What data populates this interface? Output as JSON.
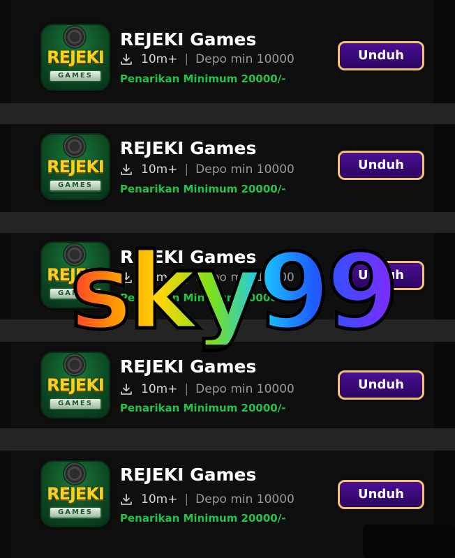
{
  "watermark": "sky99",
  "icon": {
    "word": "REJEKI",
    "sub": "GAMES",
    "name": "rejeki-games-logo"
  },
  "colors": {
    "background": "#242424",
    "card": "#0c0c0c",
    "title": "#ffffff",
    "withdraw": "#25c24a",
    "button_bg": "#3a0a7a",
    "button_border": "#f3c56b"
  },
  "apps": [
    {
      "title": "REJEKI Games",
      "downloads": "10m+",
      "separator": "|",
      "deposit": "Depo min 10000",
      "withdraw": "Penarikan Minimum 20000/-",
      "button": "Unduh"
    },
    {
      "title": "REJEKI Games",
      "downloads": "10m+",
      "separator": "|",
      "deposit": "Depo min 10000",
      "withdraw": "Penarikan Minimum 20000/-",
      "button": "Unduh"
    },
    {
      "title": "REJEKI Games",
      "downloads": "10m+",
      "separator": "|",
      "deposit": "Depo min 10000",
      "withdraw": "Penarikan Minimum 20000/-",
      "button": "Unduh"
    },
    {
      "title": "REJEKI Games",
      "downloads": "10m+",
      "separator": "|",
      "deposit": "Depo min 10000",
      "withdraw": "Penarikan Minimum 20000/-",
      "button": "Unduh"
    },
    {
      "title": "REJEKI Games",
      "downloads": "10m+",
      "separator": "|",
      "deposit": "Depo min 10000",
      "withdraw": "Penarikan Minimum 20000/-",
      "button": "Unduh"
    }
  ]
}
